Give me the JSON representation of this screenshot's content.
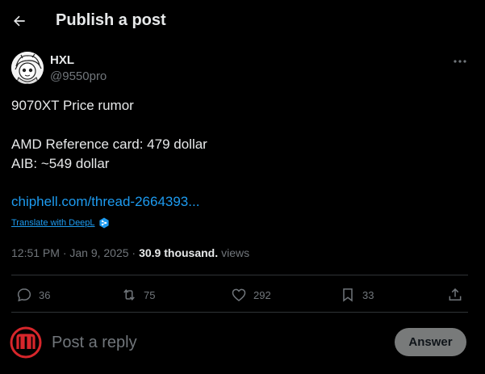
{
  "header": {
    "title": "Publish a post"
  },
  "post": {
    "author_name": "HXL",
    "author_handle": "@9550pro",
    "lines": [
      "9070XT Price rumor",
      "AMD Reference card: 479 dollar",
      "AIB: ~549 dollar"
    ],
    "link": "chiphell.com/thread-2664393...",
    "translate_label": "Translate with DeepL",
    "timestamp": "12:51 PM · Jan 9, 2025 ·",
    "views_count": "30.9 thousand.",
    "views_label": "views"
  },
  "actions": {
    "replies": "36",
    "reposts": "75",
    "likes": "292",
    "bookmarks": "33"
  },
  "reply_box": {
    "placeholder": "Post a reply",
    "button_label": "Answer"
  },
  "colors": {
    "background": "#000000",
    "text": "#e7e9ea",
    "muted": "#71767b",
    "link": "#1d9bf0",
    "divider": "#2f3336",
    "button_bg": "#787a7a"
  }
}
